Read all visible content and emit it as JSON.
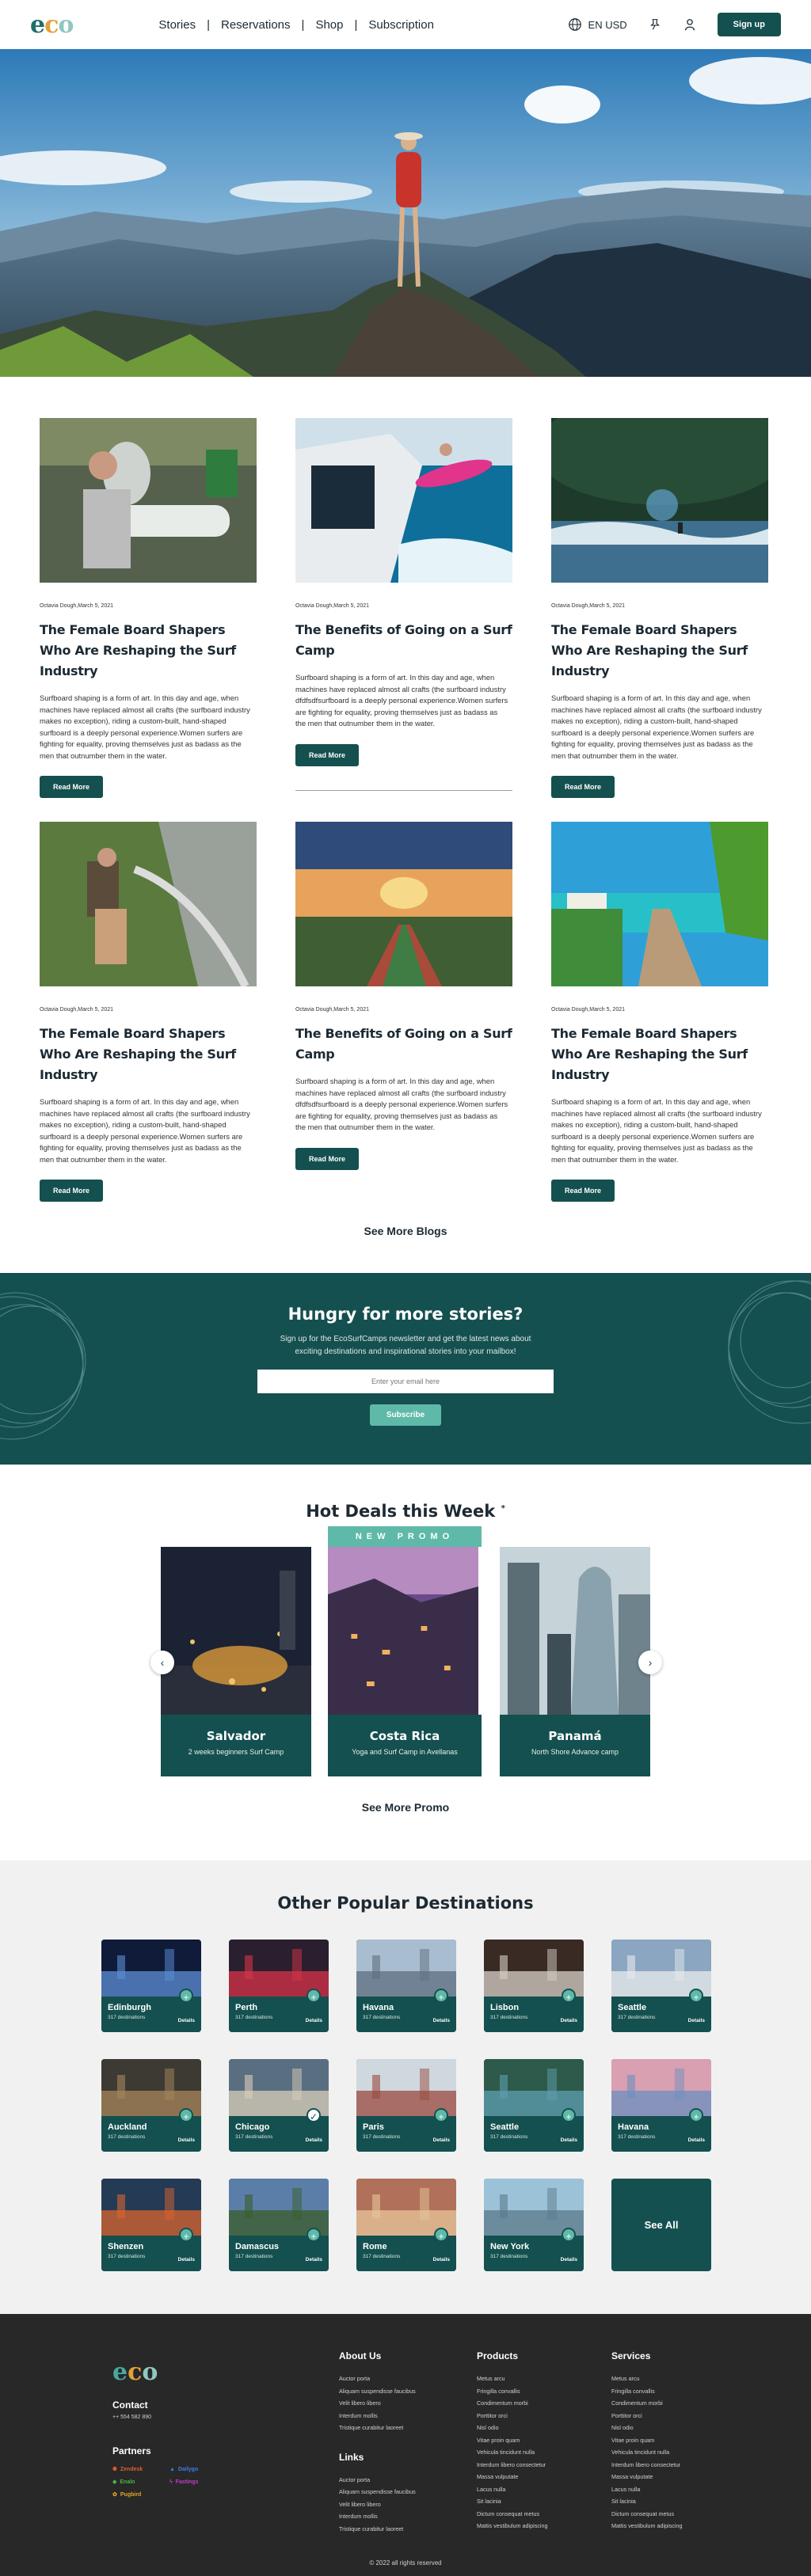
{
  "nav": {
    "logo": [
      "e",
      "c",
      "o"
    ],
    "links": [
      "Stories",
      "Reservations",
      "Shop",
      "Subscription"
    ],
    "separator": "|",
    "lang": "EN USD",
    "signup": "Sign up",
    "icons": [
      "globe-icon",
      "pin-icon",
      "user-icon"
    ]
  },
  "blogs": {
    "cards": [
      {
        "meta": "Octavia Dough,March 5, 2021",
        "title": "The Female Board Shapers Who Are Reshaping the Surf Industry",
        "body": "Surfboard shaping is a form of art. In this day and age, when machines have replaced almost all crafts (the surfboard industry makes no exception), riding a custom-built, hand-shaped surfboard is a deeply personal experience.Women surfers are fighting for equality, proving themselves just as badass as the men that outnumber them in the water.",
        "button": "Read More"
      },
      {
        "meta": "Octavia Dough,March 5, 2021",
        "title": "The Benefits of Going on a Surf Camp",
        "body": "Surfboard shaping is a form of art. In this day and age, when machines have replaced almost all crafts (the surfboard industry dfdfsdfsurfboard is a deeply personal experience.Women surfers are fighting for equality, proving themselves just as badass as the men that outnumber them in the water.",
        "button": "Read More"
      },
      {
        "meta": "Octavia Dough,March 5, 2021",
        "title": "The Female Board Shapers Who Are Reshaping the Surf Industry",
        "body": "Surfboard shaping is a form of art. In this day and age, when machines have replaced almost all crafts (the surfboard industry makes no exception), riding a custom-built, hand-shaped surfboard is a deeply personal experience.Women surfers are fighting for equality, proving themselves just as badass as the men that outnumber them in the water.",
        "button": "Read More"
      },
      {
        "meta": "Octavia Dough,March 5, 2021",
        "title": "The Female Board Shapers Who Are Reshaping the Surf Industry",
        "body": "Surfboard shaping is a form of art. In this day and age, when machines have replaced almost all crafts (the surfboard industry makes no exception), riding a custom-built, hand-shaped surfboard is a deeply personal experience.Women surfers are fighting for equality, proving themselves just as badass as the men that outnumber them in the water.",
        "button": "Read More"
      },
      {
        "meta": "Octavia Dough,March 5, 2021",
        "title": "The Benefits of Going on a Surf Camp",
        "body": "Surfboard shaping is a form of art. In this day and age, when machines have replaced almost all crafts (the surfboard industry dfdfsdfsurfboard is a deeply personal experience.Women surfers are fighting for equality, proving themselves just as badass as the men that outnumber them in the water.",
        "button": "Read More"
      },
      {
        "meta": "Octavia Dough,March 5, 2021",
        "title": "The Female Board Shapers Who Are Reshaping the Surf Industry",
        "body": "Surfboard shaping is a form of art. In this day and age, when machines have replaced almost all crafts (the surfboard industry makes no exception), riding a custom-built, hand-shaped surfboard is a deeply personal experience.Women surfers are fighting for equality, proving themselves just as badass as the men that outnumber them in the water.",
        "button": "Read More"
      }
    ],
    "see_more": "See More Blogs"
  },
  "newsletter": {
    "title": "Hungry for more stories?",
    "line1": "Sign up for the EcoSurfCamps newsletter and get the latest news about",
    "line2": "exciting destinations and inspirational stories into your mailbox!",
    "placeholder": "Enter your email here",
    "button": "Subscribe"
  },
  "deals": {
    "title": "Hot Deals this Week",
    "promo_tag": "NEW PROMO",
    "items": [
      {
        "name": "Salvador",
        "desc": "2 weeks beginners Surf Camp"
      },
      {
        "name": "Costa Rica",
        "desc": "Yoga and Surf Camp in Avellanas"
      },
      {
        "name": "Panamá",
        "desc": "North Shore Advance camp"
      }
    ],
    "see_more": "See More Promo"
  },
  "destinations": {
    "title": "Other Popular Destinations",
    "count_label": "317 destinations",
    "details": "Details",
    "see_all": "See All",
    "items": [
      "Edinburgh",
      "Perth",
      "Havana",
      "Lisbon",
      "Seattle",
      "Auckland",
      "Chicago",
      "Paris",
      "Seattle",
      "Havana",
      "Shenzen",
      "Damascus",
      "Rome",
      "New York"
    ]
  },
  "footer": {
    "contact_title": "Contact",
    "contact_phone": "++ 554 582 890",
    "partners_title": "Partners",
    "partners": [
      "Zendesk",
      "Dailygo",
      "Enalo",
      "Fastings",
      "Pugbird"
    ],
    "about_title": "About Us",
    "about_items": [
      "Auctor porta",
      "Aliquam suspendisse faucibus",
      "Velit libero libero",
      "Interdum mollis",
      "Tristique curabitur laoreet"
    ],
    "links_title": "Links",
    "links_items": [
      "Auctor porta",
      "Aliquam suspendisse faucibus",
      "Velit libero libero",
      "Interdum mollis",
      "Tristique curabitur laoreet"
    ],
    "products_title": "Products",
    "products_items": [
      "Metus arcu",
      "Fringilla convallis",
      "Condimentum morbi",
      "Porttitor orci",
      "Nisl odio",
      "Vitae proin quam",
      "Vehicula tincidunt nulla",
      "Interdum libero consectetur",
      "Massa vulputate",
      "Lacus nulla",
      "Sit lacinia",
      "Dictum consequat metus",
      "Mattis vestibulum adipiscing"
    ],
    "services_title": "Services",
    "services_items": [
      "Metus arcu",
      "Fringilla convallis",
      "Condimentum morbi",
      "Porttitor orci",
      "Nisl odio",
      "Vitae proin quam",
      "Vehicula tincidunt nulla",
      "Interdum libero consectetur",
      "Massa vulputate",
      "Lacus nulla",
      "Sit lacinia",
      "Dictum consequat metus",
      "Mattis vestibulum adipiscing"
    ],
    "copyright": "© 2022 all rights reserved"
  },
  "colors": {
    "primary": "#14504f",
    "accent": "#5fb9a8",
    "logo_e": "#1f6e6c",
    "logo_c": "#e1a13a",
    "logo_o": "#8fc8c1",
    "footer_bg": "#282828"
  }
}
